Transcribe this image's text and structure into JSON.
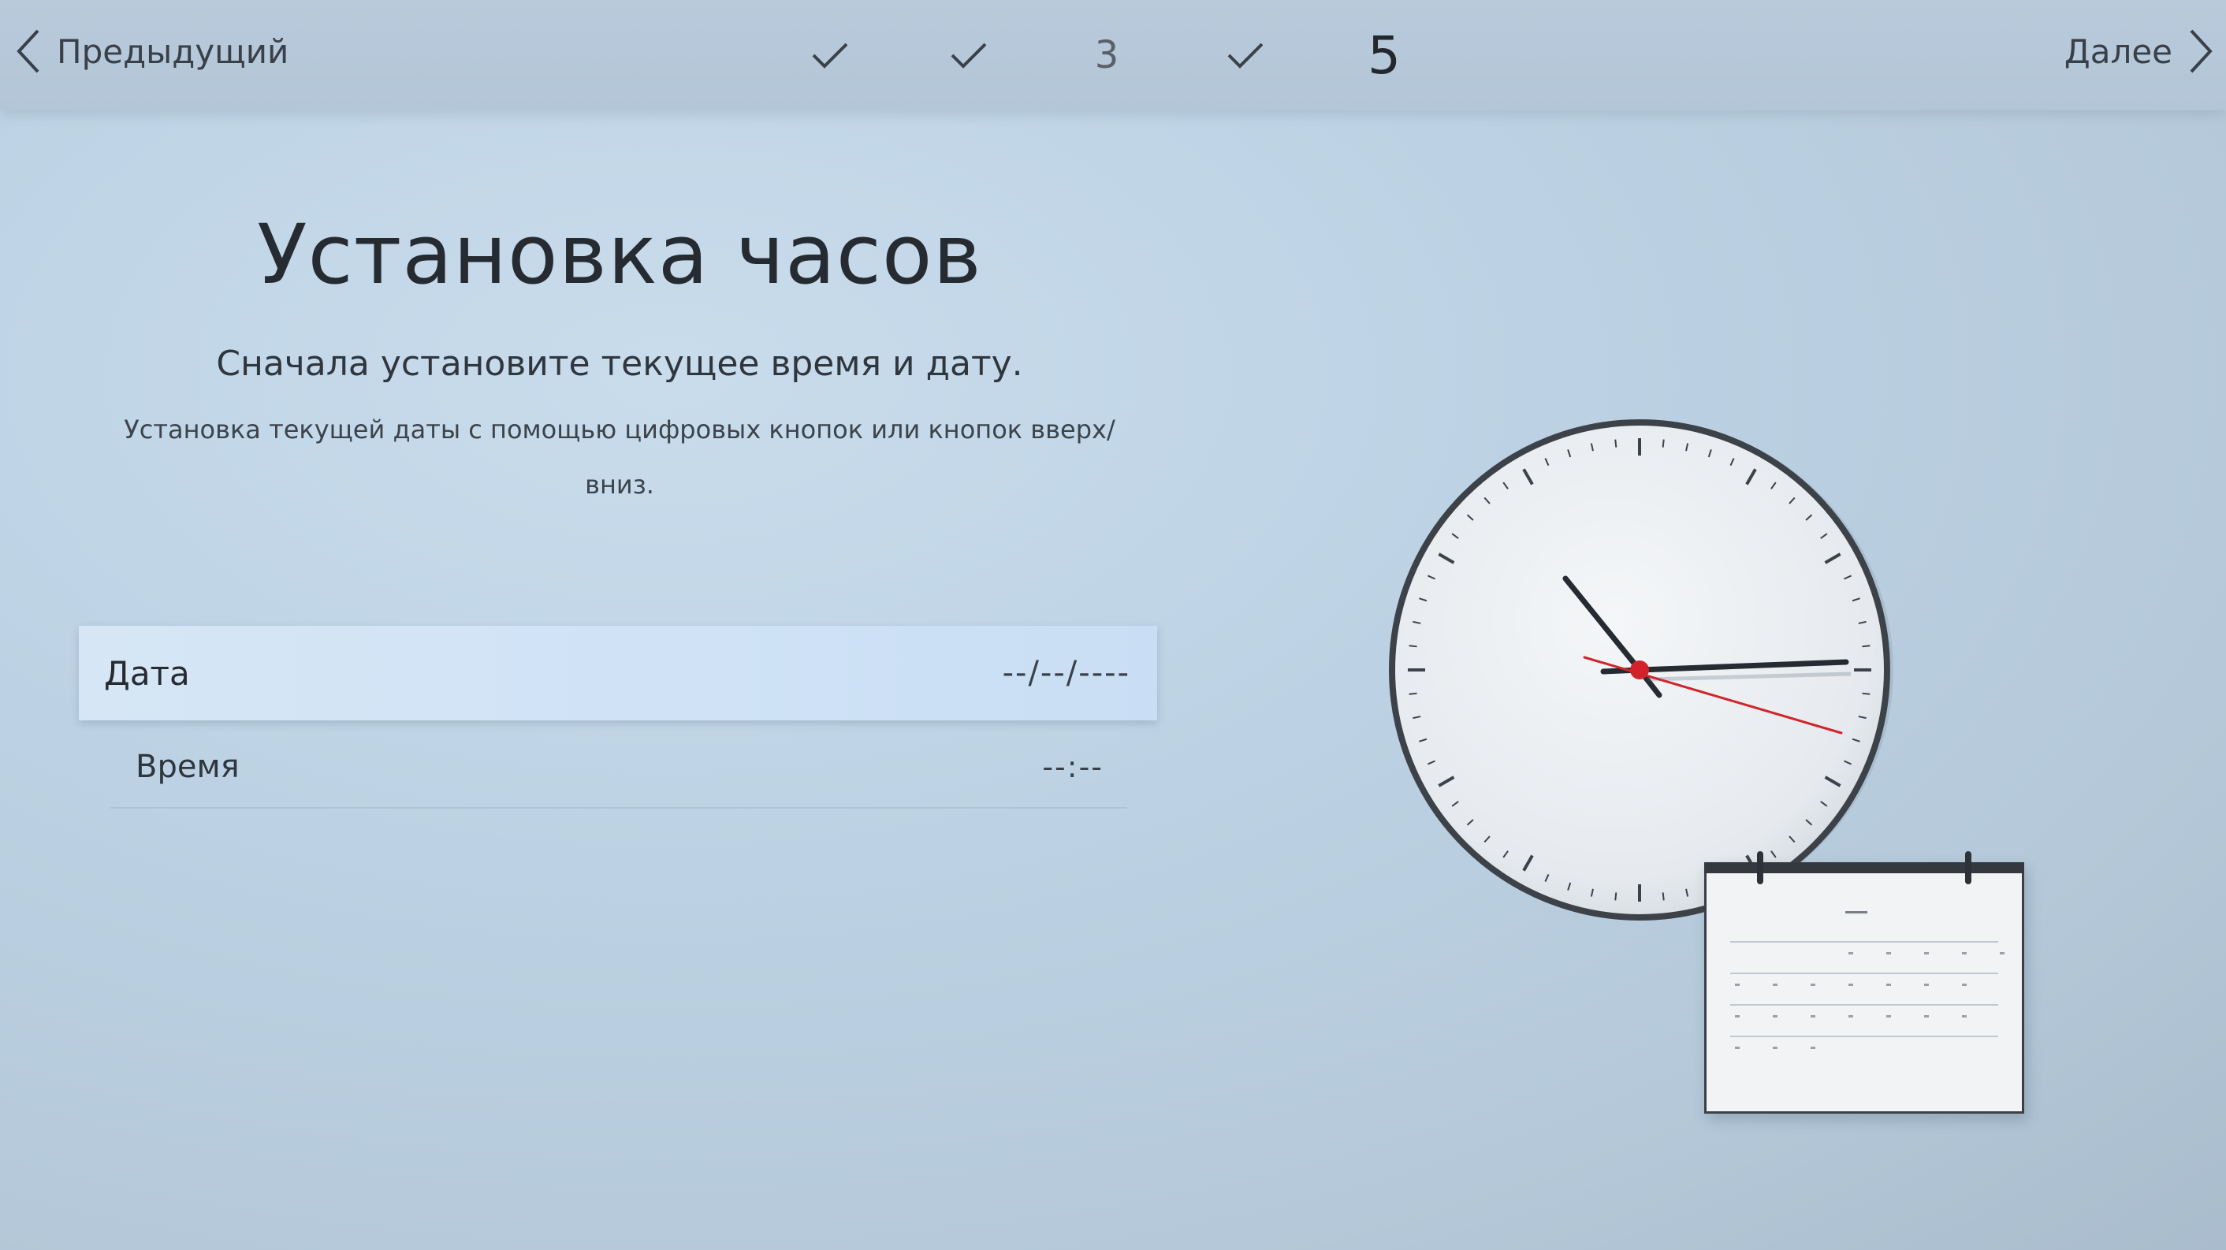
{
  "nav": {
    "prev_label": "Предыдущий",
    "next_label": "Далее"
  },
  "steps": [
    {
      "state": "done",
      "icon": "check-icon"
    },
    {
      "state": "done",
      "icon": "check-icon"
    },
    {
      "state": "pending",
      "label": "3"
    },
    {
      "state": "done",
      "icon": "check-icon"
    },
    {
      "state": "current",
      "label": "5"
    }
  ],
  "main": {
    "title": "Установка часов",
    "subtitle": "Сначала установите текущее время и дату.",
    "hint": "Установка текущей даты с помощью цифровых кнопок или кнопок вверх/вниз."
  },
  "fields": {
    "date": {
      "label": "Дата",
      "value": "--/--/----"
    },
    "time": {
      "label": "Время",
      "value": "--:--"
    }
  },
  "illustration": {
    "clock_icon": "wall-clock-icon",
    "calendar_icon": "calendar-icon"
  },
  "colors": {
    "accent_red": "#d2232a",
    "selected_row": "#cfe2f6",
    "background": "#bcd2e4"
  }
}
